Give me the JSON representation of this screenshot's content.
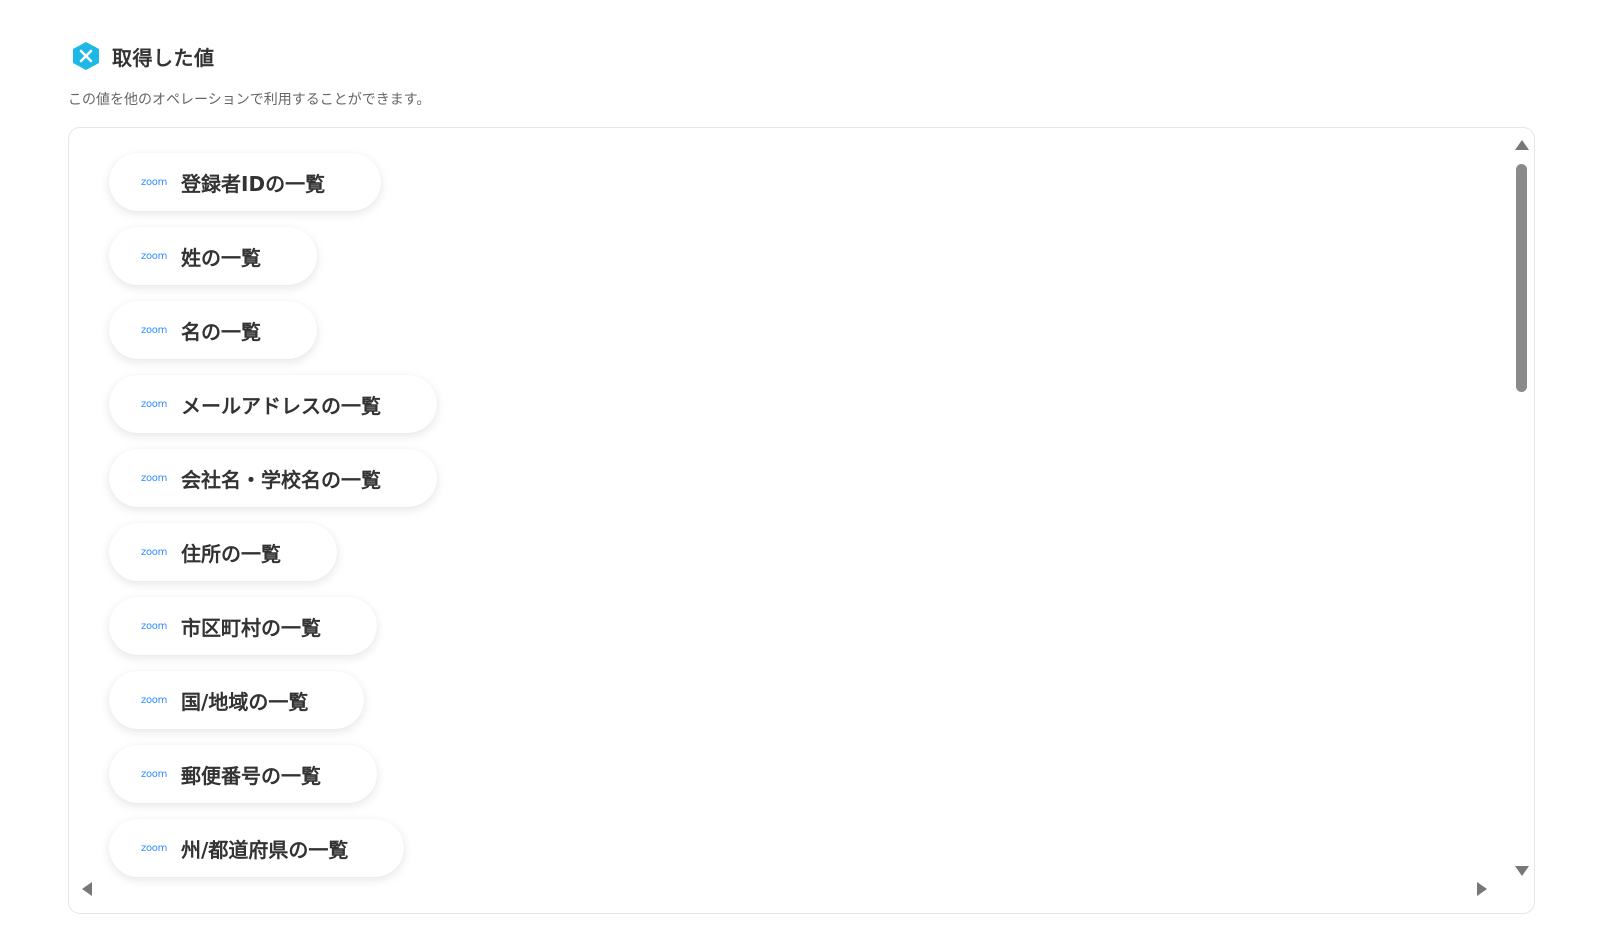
{
  "header": {
    "title": "取得した値",
    "icon": "yoom-logo-icon",
    "icon_color": "#1DB8E5"
  },
  "subtitle": "この値を他のオペレーションで利用することができます。",
  "items": [
    {
      "source": "zoom",
      "label": "登録者IDの一覧"
    },
    {
      "source": "zoom",
      "label": "姓の一覧"
    },
    {
      "source": "zoom",
      "label": "名の一覧"
    },
    {
      "source": "zoom",
      "label": "メールアドレスの一覧"
    },
    {
      "source": "zoom",
      "label": "会社名・学校名の一覧"
    },
    {
      "source": "zoom",
      "label": "住所の一覧"
    },
    {
      "source": "zoom",
      "label": "市区町村の一覧"
    },
    {
      "source": "zoom",
      "label": "国/地域の一覧"
    },
    {
      "source": "zoom",
      "label": "郵便番号の一覧"
    },
    {
      "source": "zoom",
      "label": "州/都道府県の一覧"
    }
  ],
  "colors": {
    "zoom_brand": "#2D8CFF",
    "text": "#333333",
    "subtext": "#666666"
  }
}
